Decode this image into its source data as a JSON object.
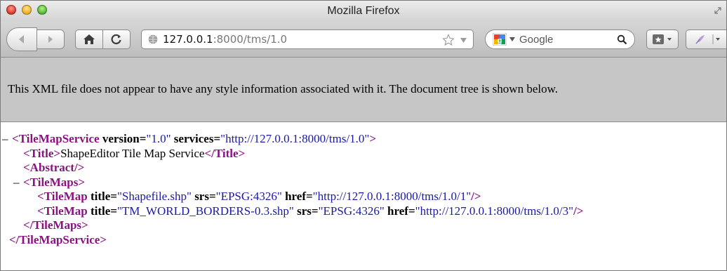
{
  "window": {
    "title": "Mozilla Firefox"
  },
  "toolbar": {
    "url_host": "127.0.0.1",
    "url_rest": ":8000/tms/1.0",
    "search_placeholder": "Google",
    "icons": [
      "back-icon",
      "forward-icon",
      "home-icon",
      "reload-icon",
      "globe-icon",
      "bookmark-star-icon",
      "google-logo-icon",
      "search-icon",
      "bookmarks-menu-icon",
      "extension-icon"
    ]
  },
  "infobar": {
    "message": "This XML file does not appear to have any style information associated with it. The document tree is shown below."
  },
  "xml": {
    "collapse_symbol": "–",
    "root": {
      "open_lt": "<",
      "tag": "TileMapService",
      "attrs": [
        {
          "name": "version",
          "value": "\"1.0\""
        },
        {
          "name": "services",
          "value": "\"http://127.0.0.1:8000/tms/1.0\""
        }
      ],
      "open_gt": ">",
      "close": "</TileMapService>"
    },
    "title": {
      "open": "<Title>",
      "text": "ShapeEditor Tile Map Service",
      "close": "</Title>"
    },
    "abstract": {
      "open": "<Abstract/>"
    },
    "tilemaps": {
      "open": "<TileMaps>",
      "close": "</TileMaps>",
      "items": [
        {
          "tag": "TileMap",
          "title": "\"Shapefile.shp\"",
          "srs": "\"EPSG:4326\"",
          "href": "\"http://127.0.0.1:8000/tms/1.0/1\""
        },
        {
          "tag": "TileMap",
          "title": "\"TM_WORLD_BORDERS-0.3.shp\"",
          "srs": "\"EPSG:4326\"",
          "href": "\"http://127.0.0.1:8000/tms/1.0/3\""
        }
      ]
    },
    "labels": {
      "title_attr": "title",
      "srs_attr": "srs",
      "href_attr": "href",
      "eq": "=",
      "self_close": "/>"
    }
  },
  "colors": {
    "tag": "#881280",
    "value": "#1a1aa6",
    "infobar_bg": "#c6c6c6"
  }
}
